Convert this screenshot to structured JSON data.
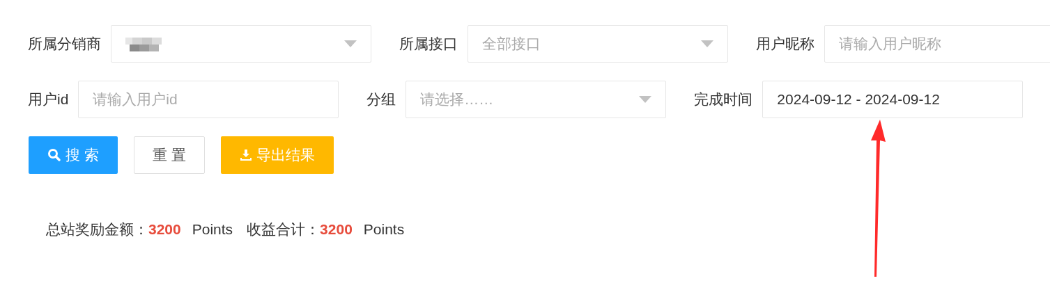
{
  "filters": [
    [
      {
        "label": "所属分销商",
        "kind": "select",
        "masked": true
      },
      {
        "label": "所属接口",
        "kind": "select",
        "placeholder": "全部接口"
      },
      {
        "label": "用户昵称",
        "kind": "input",
        "placeholder": "请输入用户昵称"
      }
    ],
    [
      {
        "label": "用户id",
        "kind": "input",
        "placeholder": "请输入用户id"
      },
      {
        "label": "分组",
        "kind": "select",
        "placeholder": "请选择……"
      },
      {
        "label": "完成时间",
        "kind": "input",
        "value": "2024-09-12 - 2024-09-12"
      }
    ]
  ],
  "buttons": [
    {
      "label": "搜 索",
      "kind": "primary"
    },
    {
      "label": "重 置",
      "kind": "default"
    },
    {
      "label": "导出结果",
      "kind": "warning"
    }
  ],
  "summary": [
    {
      "label": "总站奖励金额：",
      "amount": "3200",
      "unit": "Points"
    },
    {
      "label": "收益合计：",
      "amount": "3200",
      "unit": "Points"
    }
  ]
}
